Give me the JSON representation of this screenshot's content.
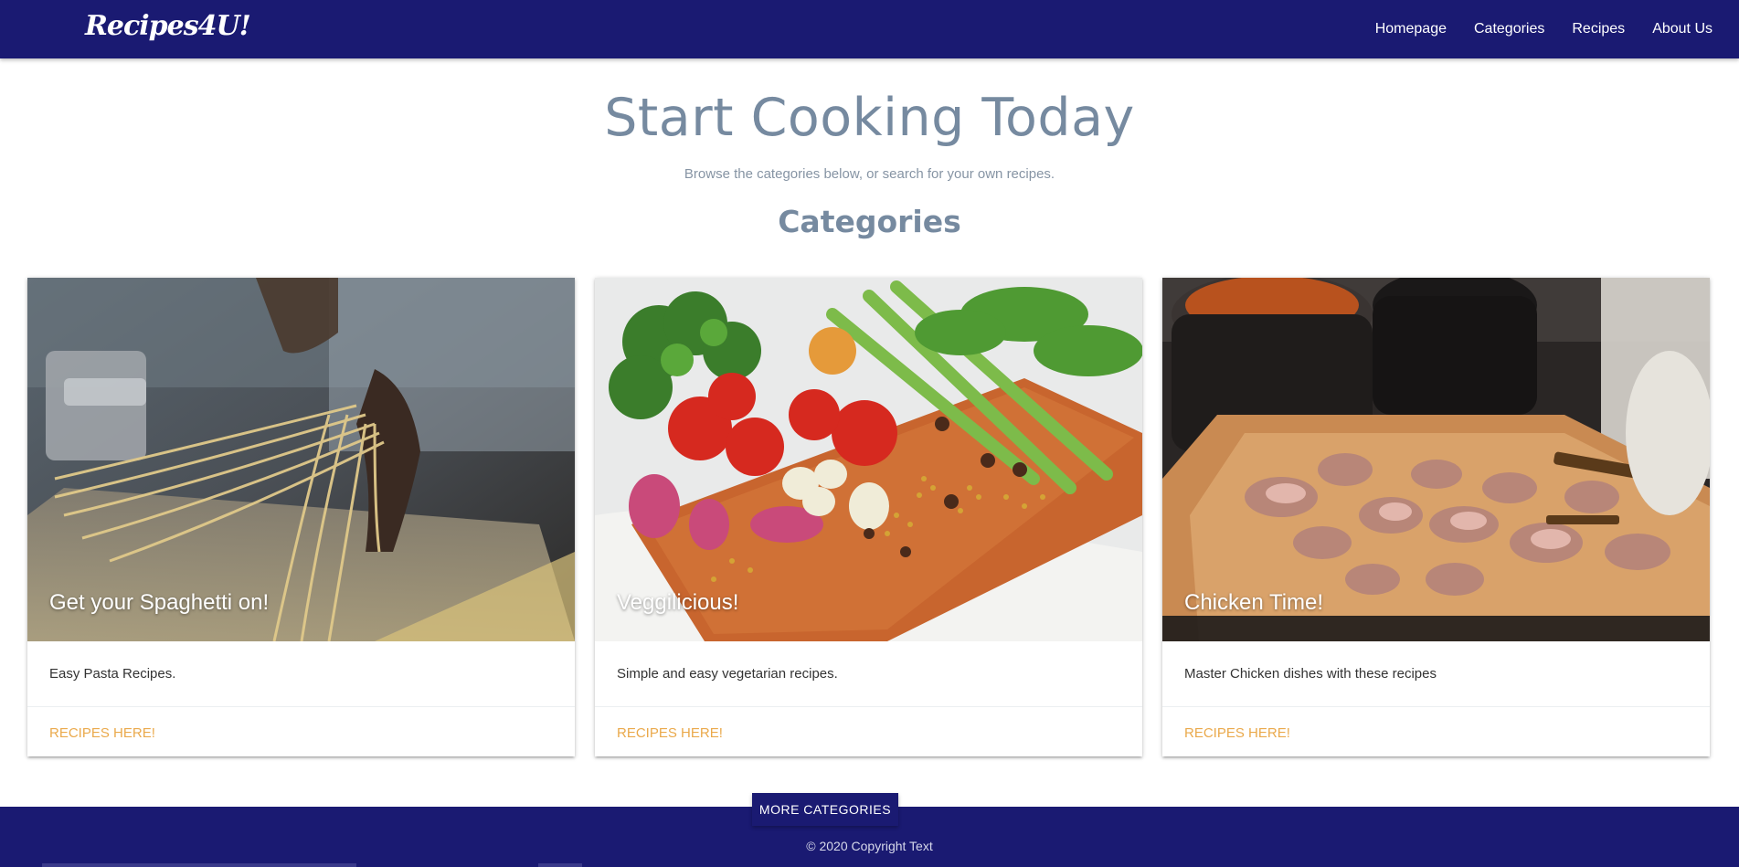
{
  "navbar": {
    "brand": "Recipes4U!",
    "links": [
      {
        "label": "Homepage"
      },
      {
        "label": "Categories"
      },
      {
        "label": "Recipes"
      },
      {
        "label": "About Us"
      }
    ]
  },
  "hero": {
    "title": "Start Cooking Today",
    "subtitle": "Browse the categories below, or search for your own recipes."
  },
  "categories": {
    "heading": "Categories",
    "cards": [
      {
        "title": "Get your Spaghetti on!",
        "description": "Easy Pasta Recipes.",
        "action": "RECIPES HERE!"
      },
      {
        "title": "Veggilicious!",
        "description": "Simple and easy vegetarian recipes.",
        "action": "RECIPES HERE!"
      },
      {
        "title": "Chicken Time!",
        "description": "Master Chicken dishes with these recipes",
        "action": "RECIPES HERE!"
      }
    ],
    "more_button": "MORE CATEGORIES"
  },
  "footer": {
    "copyright": "© 2020 Copyright Text"
  },
  "colors": {
    "navbar": "#1a1a72",
    "heading": "#768aa0",
    "action": "#eaa94b"
  }
}
